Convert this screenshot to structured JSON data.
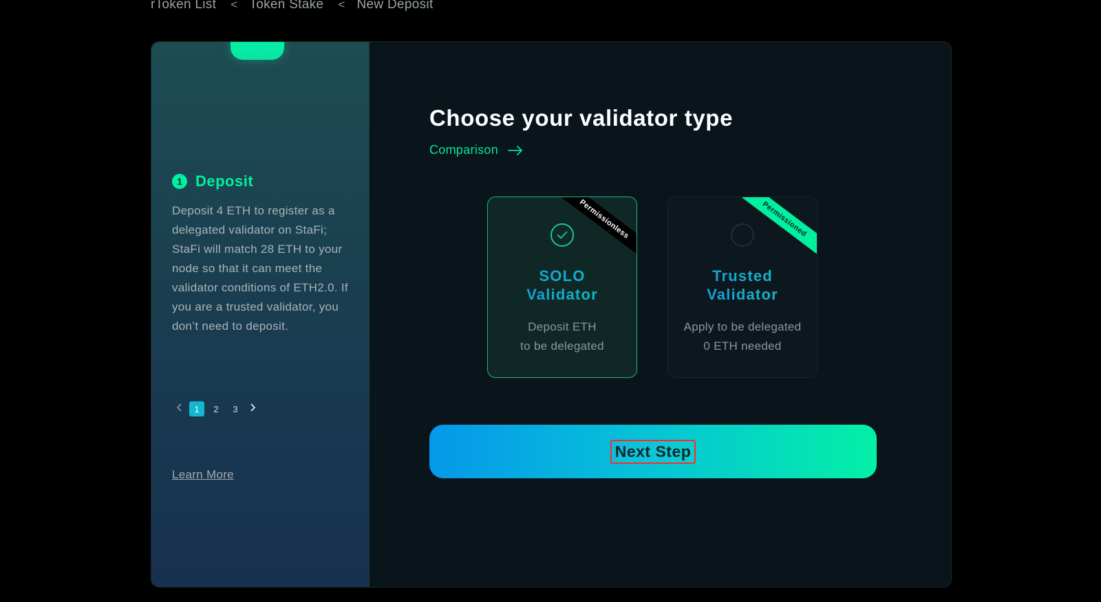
{
  "breadcrumb": {
    "items": [
      "rToken List",
      "Token Stake",
      "New Deposit"
    ]
  },
  "sidebar": {
    "step_number": "1",
    "step_title": "Deposit",
    "step_description": "Deposit 4 ETH to register as a delegated validator on StaFi; StaFi will match 28 ETH to your node so that it can meet the validator conditions of ETH2.0. If you are a trusted validator, you don’t need to deposit.",
    "pager": {
      "pages": [
        "1",
        "2",
        "3"
      ],
      "current": "1"
    },
    "learn_more": "Learn More"
  },
  "main": {
    "title": "Choose your validator type",
    "comparison_link": "Comparison",
    "cards": [
      {
        "ribbon": "Permissionless",
        "title_line1": "SOLO",
        "title_line2": "Validator",
        "desc_line1": "Deposit ETH",
        "desc_line2": "to be delegated",
        "selected": true
      },
      {
        "ribbon": "Permissioned",
        "title_line1": "Trusted",
        "title_line2": "Validator",
        "desc_line1": "Apply to be delegated",
        "desc_line2": "0 ETH needed",
        "selected": false
      }
    ],
    "next_button": "Next Step"
  },
  "colors": {
    "accent": "#00F0A0",
    "gradient_start": "#0698EA",
    "gradient_end": "#03F0A6",
    "background": "#000000",
    "panel": "#0A141B"
  }
}
